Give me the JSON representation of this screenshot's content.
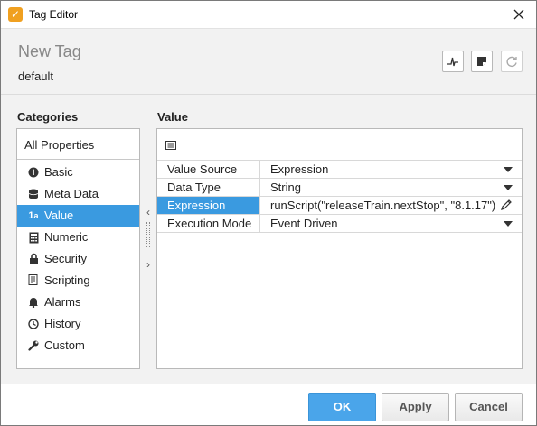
{
  "window": {
    "title": "Tag Editor"
  },
  "header": {
    "tag_name": "New Tag",
    "provider": "default"
  },
  "categories": {
    "label": "Categories",
    "all_properties": "All Properties",
    "items": [
      {
        "label": "Basic",
        "icon": "info-icon"
      },
      {
        "label": "Meta Data",
        "icon": "database-icon"
      },
      {
        "label": "Value",
        "icon": "value-type-icon"
      },
      {
        "label": "Numeric",
        "icon": "calculator-icon"
      },
      {
        "label": "Security",
        "icon": "lock-icon"
      },
      {
        "label": "Scripting",
        "icon": "script-icon"
      },
      {
        "label": "Alarms",
        "icon": "bell-icon"
      },
      {
        "label": "History",
        "icon": "clock-icon"
      },
      {
        "label": "Custom",
        "icon": "wrench-icon"
      }
    ],
    "selected": "Value"
  },
  "value_section": {
    "label": "Value",
    "properties": [
      {
        "name": "Value Source",
        "value": "Expression",
        "control": "dropdown"
      },
      {
        "name": "Data Type",
        "value": "String",
        "control": "dropdown"
      },
      {
        "name": "Expression",
        "value": "runScript(\"releaseTrain.nextStop\", \"8.1.17\")",
        "control": "edit"
      },
      {
        "name": "Execution Mode",
        "value": "Event Driven",
        "control": "dropdown"
      }
    ],
    "selected_property": "Expression"
  },
  "buttons": {
    "ok": "OK",
    "apply": "Apply",
    "cancel": "Cancel"
  },
  "colors": {
    "selection": "#3a9ae0",
    "primary_button": "#4aa5ea",
    "app_icon": "#f0a020"
  }
}
